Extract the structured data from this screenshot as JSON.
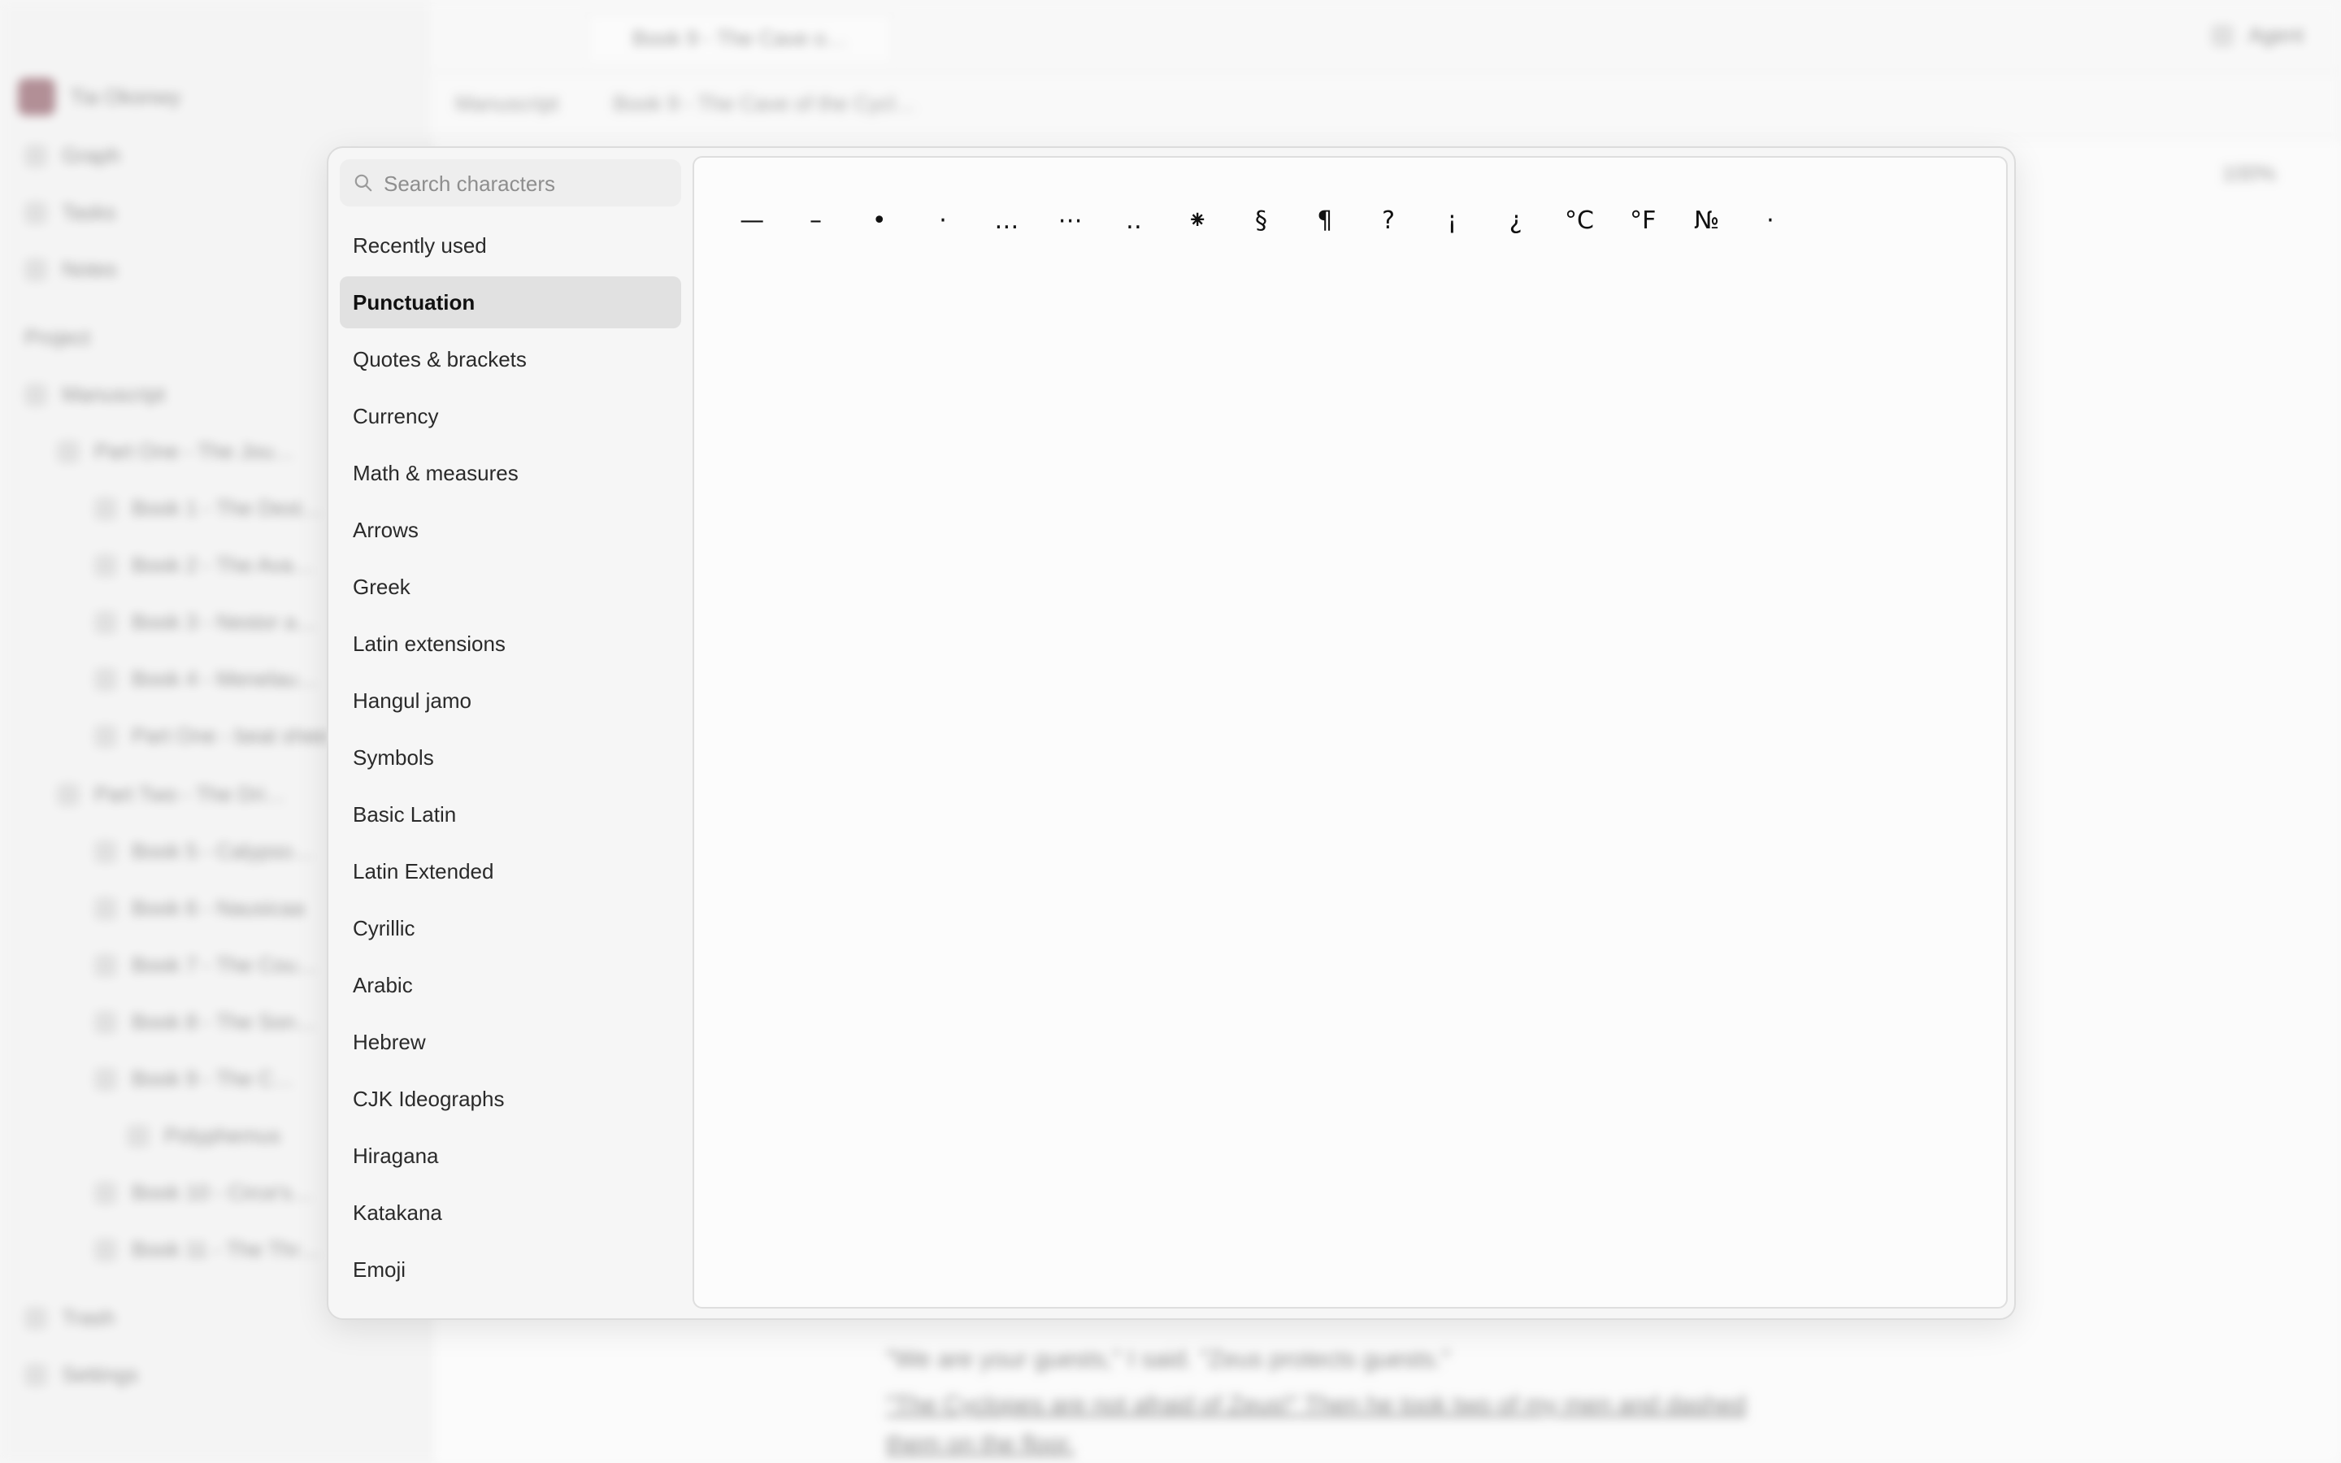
{
  "background": {
    "user_name": "Tia Okonwy",
    "nav": [
      "Graph",
      "Tasks",
      "Notes"
    ],
    "project_label": "Project",
    "manuscript_label": "Manuscript",
    "tree": [
      "Part One - The Jou…",
      "Book 1 - The Dest…",
      "Book 2 - The Ava…",
      "Book 3 - Nestor a…",
      "Book 4 - Menelau…",
      "Part One - beat shee",
      "Part Two - The Dri…",
      "Book 5 - Calypso…",
      "Book 6 - Nausicaa",
      "Book 7 - The Cou…",
      "Book 8 - The Son…",
      "Book 9 - The C…",
      "Polyphemus",
      "Book 10 - Circe's…",
      "Book 11 - The Thr…"
    ],
    "trash_label": "Trash",
    "settings_label": "Settings",
    "tab_title": "Book 9 - The Cave o…",
    "agent_label": "Agent",
    "breadcrumb_root": "Manuscript",
    "breadcrumb_current": "Book 9 - The Cave of the Cycl…",
    "zoom": "100%",
    "text_line_1": "\"We are your guests,\" I said. \"Zeus protects guests.\"",
    "text_line_2": "\"The Cyclopes are not afraid of Zeus!\" Then he took two of my men and dashed",
    "text_line_3": "them on the floor."
  },
  "picker": {
    "search_placeholder": "Search characters",
    "categories": [
      "Recently used",
      "Punctuation",
      "Quotes & brackets",
      "Currency",
      "Math & measures",
      "Arrows",
      "Greek",
      "Latin extensions",
      "Hangul jamo",
      "Symbols",
      "Basic Latin",
      "Latin Extended",
      "Cyrillic",
      "Arabic",
      "Hebrew",
      "CJK Ideographs",
      "Hiragana",
      "Katakana",
      "Emoji"
    ],
    "active_category": "Punctuation",
    "glyphs": [
      "—",
      "–",
      "•",
      "·",
      "…",
      "⋯",
      "‥",
      "⁕",
      "§",
      "¶",
      "?",
      "¡",
      "¿",
      "°C",
      "°F",
      "№",
      "·"
    ]
  }
}
